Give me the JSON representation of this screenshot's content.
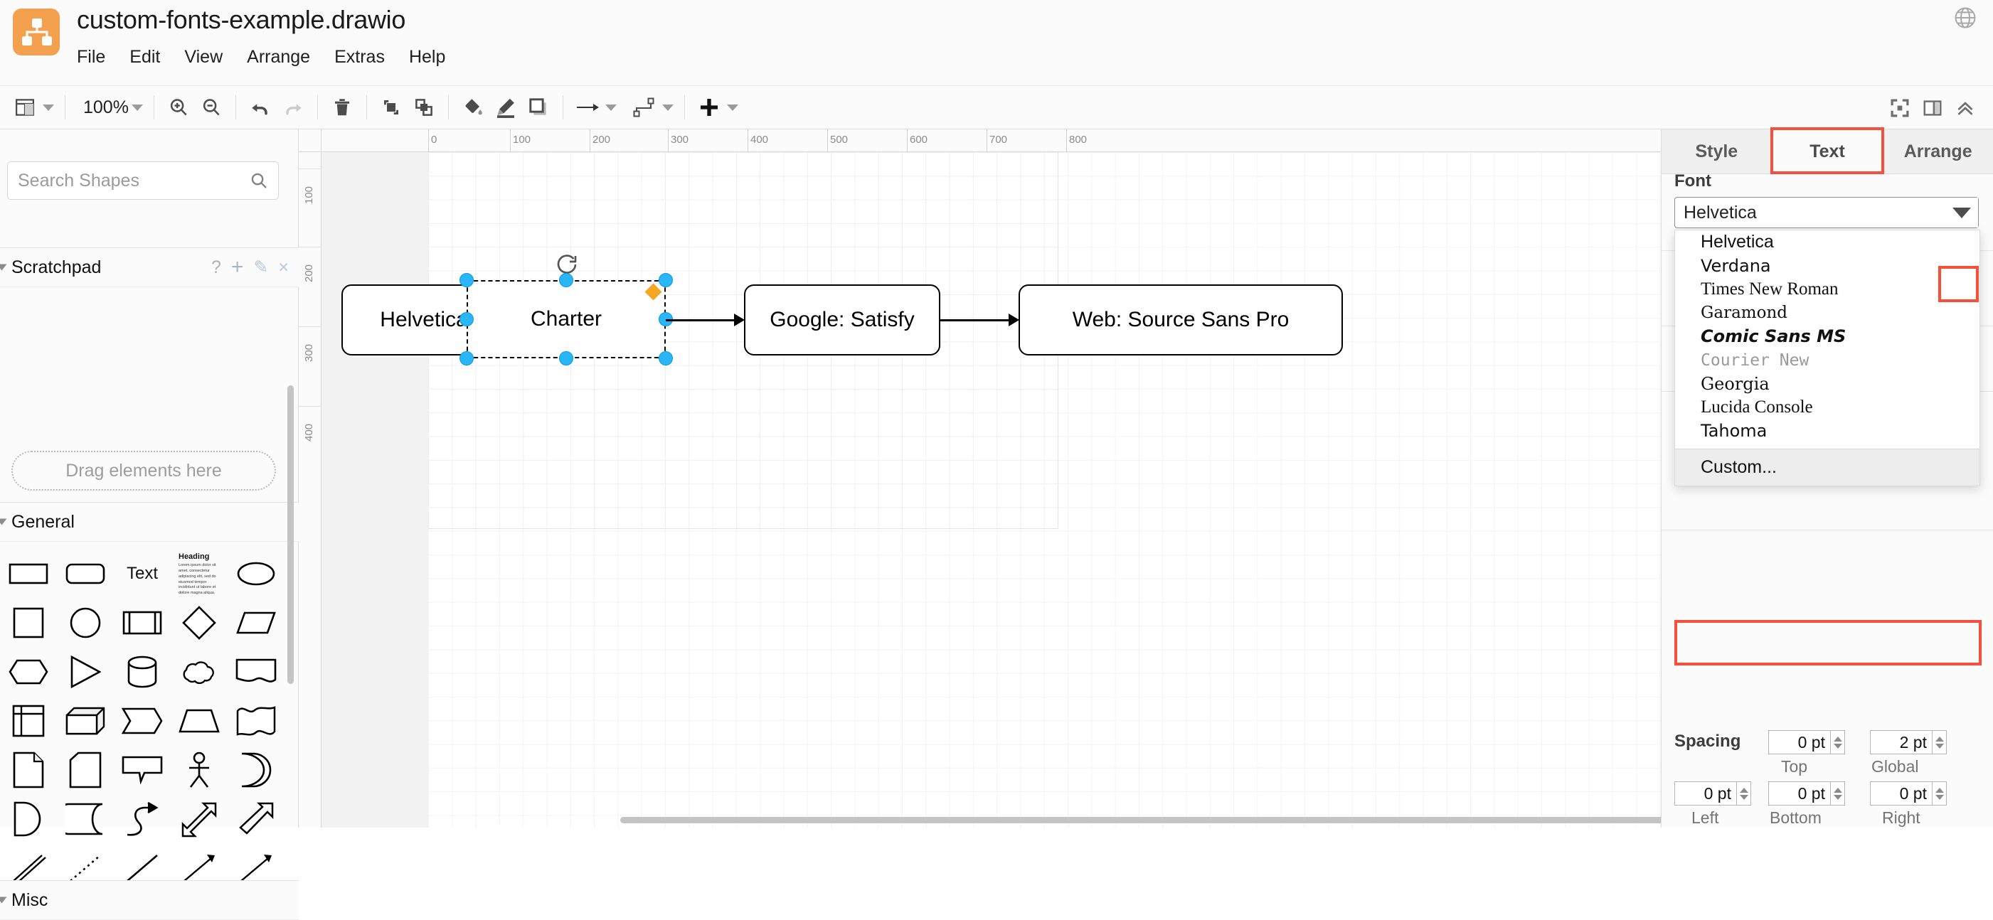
{
  "app": {
    "title": "custom-fonts-example.drawio",
    "logo_icon": "drawio-logo-icon",
    "globe_icon": "globe-icon"
  },
  "menubar": {
    "items": [
      {
        "label": "File",
        "name": "menu-file"
      },
      {
        "label": "Edit",
        "name": "menu-edit"
      },
      {
        "label": "View",
        "name": "menu-view"
      },
      {
        "label": "Arrange",
        "name": "menu-arrange"
      },
      {
        "label": "Extras",
        "name": "menu-extras"
      },
      {
        "label": "Help",
        "name": "menu-help"
      }
    ]
  },
  "toolbar": {
    "zoom_level": "100%",
    "icons": [
      "view-layout-icon",
      "zoom-in-icon",
      "zoom-out-icon",
      "undo-icon",
      "redo-icon",
      "delete-icon",
      "to-front-icon",
      "to-back-icon",
      "fill-color-icon",
      "line-color-icon",
      "shadow-icon",
      "connection-arrow-icon",
      "waypoints-icon",
      "insert-plus-icon",
      "fullscreen-icon",
      "format-panel-icon",
      "collapse-toolbar-icon"
    ]
  },
  "left_panel": {
    "search": {
      "placeholder": "Search Shapes",
      "value": "",
      "icon": "search-icon"
    },
    "scratchpad": {
      "label": "Scratchpad",
      "help_icon": "?",
      "add_icon": "+",
      "edit_icon": "✎",
      "close_icon": "×",
      "drop_hint": "Drag elements here"
    },
    "sections": [
      {
        "label": "General"
      },
      {
        "label": "Misc"
      }
    ],
    "shapes": [
      [
        "rectangle-shape",
        "rounded-rectangle-shape",
        "text-shape",
        "heading-textblock-shape",
        "ellipse-shape"
      ],
      [
        "square-shape",
        "circle-shape",
        "process-shape",
        "diamond-shape",
        "parallelogram-shape"
      ],
      [
        "hexagon-shape",
        "triangle-shape",
        "cylinder-shape",
        "cloud-shape",
        "document-shape"
      ],
      [
        "internal-storage-shape",
        "cube-shape",
        "step-shape",
        "trapezoid-shape",
        "tape-shape"
      ],
      [
        "note-shape",
        "card-shape",
        "callout-shape",
        "actor-shape",
        "delay-shape"
      ],
      [
        "or-shape",
        "data-storage-shape",
        "curved-arrow-shape",
        "double-arrow-shape",
        "arrow-shape"
      ],
      [
        "double-line-shape",
        "dotted-line-shape",
        "line-shape",
        "directional-connector-shape",
        "bidirectional-connector-shape"
      ]
    ],
    "shape_text": {
      "text_label": "Text",
      "heading_label": "Heading",
      "lorem": "Lorem ipsum dolor sit amet, consectetur adipiscing elit, sed do eiusmod tempor incididunt ut labore et dolore magna aliqua."
    }
  },
  "canvas": {
    "ruler_h_labels": [
      "0",
      "100",
      "200",
      "300",
      "400",
      "500",
      "600",
      "700",
      "800"
    ],
    "ruler_v_labels": [
      "100",
      "200",
      "300",
      "400"
    ],
    "nodes": [
      {
        "label": "Helvetica",
        "name": "node-helvetica",
        "selected": false
      },
      {
        "label": "Charter",
        "name": "node-charter",
        "selected": true
      },
      {
        "label": "Google: Satisfy",
        "name": "node-google-satisfy",
        "selected": false
      },
      {
        "label": "Web: Source Sans Pro",
        "name": "node-web-source-sans-pro",
        "selected": false
      }
    ],
    "rotate_icon": "rotate-handle-icon",
    "selection_handle": "resize-handle",
    "round_handle": "rounding-handle"
  },
  "right_panel": {
    "tabs": [
      {
        "label": "Style",
        "name": "tab-style",
        "active": false
      },
      {
        "label": "Text",
        "name": "tab-text",
        "active": true
      },
      {
        "label": "Arrange",
        "name": "tab-arrange",
        "active": false
      }
    ],
    "font": {
      "section_label": "Font",
      "value": "Helvetica",
      "dropdown_icon": "chevron-down-icon",
      "options": [
        {
          "label": "Helvetica",
          "style": "f-helv"
        },
        {
          "label": "Verdana",
          "style": "f-verd"
        },
        {
          "label": "Times New Roman",
          "style": "f-times"
        },
        {
          "label": "Garamond",
          "style": "f-gara"
        },
        {
          "label": "Comic Sans MS",
          "style": "f-comic"
        },
        {
          "label": "Courier New",
          "style": "f-cour"
        },
        {
          "label": "Georgia",
          "style": "f-georg"
        },
        {
          "label": "Lucida Console",
          "style": "f-lucid"
        },
        {
          "label": "Tahoma",
          "style": "f-tahoma"
        }
      ],
      "custom_label": "Custom..."
    },
    "spacing": {
      "label": "Spacing",
      "top": {
        "value": "0 pt",
        "caption": "Top"
      },
      "global": {
        "value": "2 pt",
        "caption": "Global"
      },
      "left": {
        "value": "0 pt",
        "caption": "Left"
      },
      "bottom": {
        "value": "0 pt",
        "caption": "Bottom"
      },
      "right": {
        "value": "0 pt",
        "caption": "Right"
      }
    }
  },
  "annotations": {
    "accent_color": "#f4503c",
    "boxes": [
      "tab-text-highlight",
      "font-dropdown-arrow-highlight",
      "custom-option-highlight"
    ]
  }
}
